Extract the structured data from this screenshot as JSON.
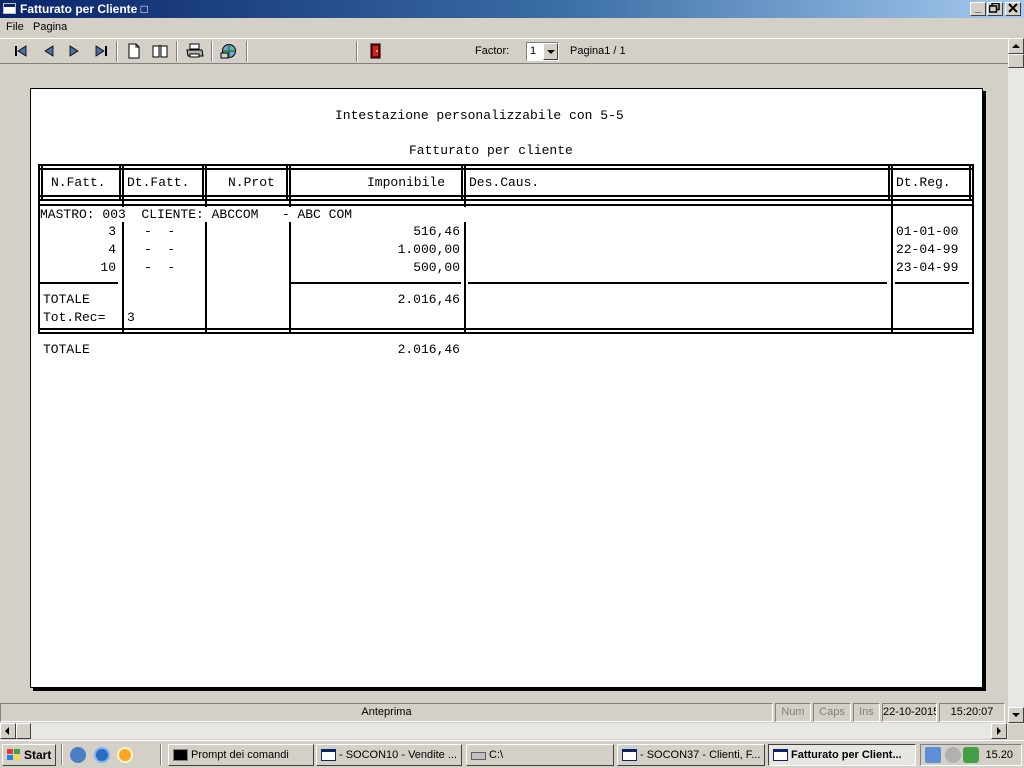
{
  "window": {
    "title": "Fatturato per Cliente □"
  },
  "menu": {
    "items": [
      "File",
      "Pagina"
    ]
  },
  "toolbar": {
    "factor_label": "Factor:",
    "factor_value": "1",
    "page_label": "Pagina1 / 1"
  },
  "report": {
    "header": "Intestazione personalizzabile con 5-5",
    "title": "Fatturato per cliente",
    "columns": [
      "N.Fatt.",
      "Dt.Fatt.",
      "N.Prot",
      "Imponibile",
      "Des.Caus.",
      "Dt.Reg."
    ],
    "group_label": "MASTRO: 003  CLIENTE: ABCCOM   - ABC COM",
    "rows": [
      {
        "n_fatt": "3",
        "dt_fatt": "-  -",
        "imponibile": "516,46",
        "dt_reg": "01-01-00"
      },
      {
        "n_fatt": "4",
        "dt_fatt": "-  -",
        "imponibile": "1.000,00",
        "dt_reg": "22-04-99"
      },
      {
        "n_fatt": "10",
        "dt_fatt": "-  -",
        "imponibile": "500,00",
        "dt_reg": "23-04-99"
      }
    ],
    "subtotal": {
      "label": "TOTALE",
      "value": "2.016,46",
      "rec_label": "Tot.Rec=",
      "rec_value": "3"
    },
    "grand_total": {
      "label": "TOTALE",
      "value": "2.016,46"
    }
  },
  "statusbar": {
    "mode": "Anteprima",
    "num": "Num",
    "caps": "Caps",
    "ins": "Ins",
    "date": "22-10-2015",
    "time": "15:20:07"
  },
  "taskbar": {
    "start": "Start",
    "tasks": [
      "Prompt dei comandi",
      "- SOCON10 - Vendite ...",
      "C:\\",
      "- SOCON37 - Clienti, F...",
      "Fatturato per Client..."
    ],
    "clock": "15.20"
  }
}
